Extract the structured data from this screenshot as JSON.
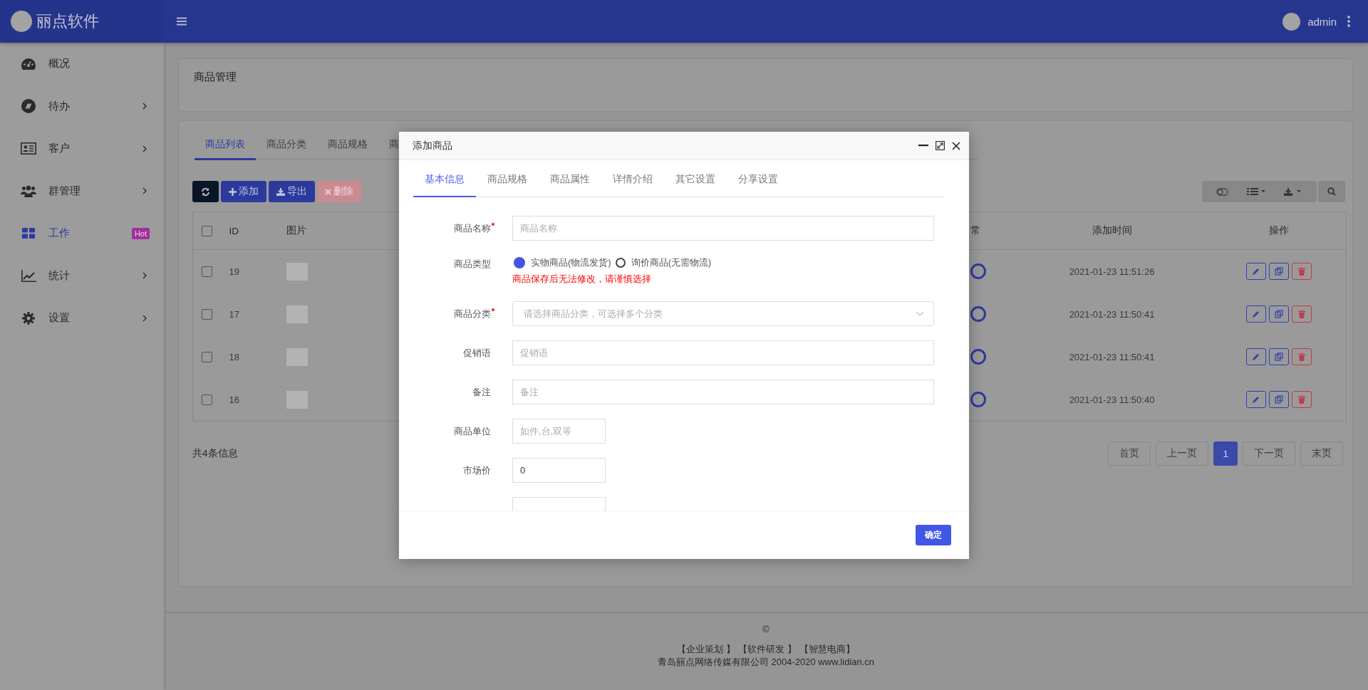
{
  "header": {
    "logo_text": "丽点软件",
    "user": "admin"
  },
  "sidebar": {
    "items": [
      {
        "label": "概况",
        "expandable": false,
        "selected": false
      },
      {
        "label": "待办",
        "expandable": true,
        "selected": false
      },
      {
        "label": "客户",
        "expandable": true,
        "selected": false
      },
      {
        "label": "群管理",
        "expandable": true,
        "selected": false
      },
      {
        "label": "工作",
        "badge": "Hot",
        "expandable": false,
        "selected": true
      },
      {
        "label": "统计",
        "expandable": true,
        "selected": false
      },
      {
        "label": "设置",
        "expandable": true,
        "selected": false
      }
    ]
  },
  "page_title": "商品管理",
  "tabs": [
    {
      "label": "商品列表",
      "selected": true
    },
    {
      "label": "商品分类",
      "selected": false
    },
    {
      "label": "商品规格",
      "selected": false
    },
    {
      "label": "商",
      "selected": false
    }
  ],
  "toolbar": [
    {
      "kind": "refresh",
      "disabled": false
    },
    {
      "kind": "add",
      "label": "添加",
      "disabled": false
    },
    {
      "kind": "export",
      "label": "导出",
      "disabled": false
    },
    {
      "kind": "delete",
      "label": "删除",
      "disabled": true
    }
  ],
  "table": {
    "all_checked": false,
    "columns": [
      "ID",
      "图片",
      "常",
      "添加时间",
      "操作"
    ],
    "rows": [
      {
        "checked": false,
        "id": "19",
        "time": "2021-01-23 11:51:26"
      },
      {
        "checked": false,
        "id": "17",
        "time": "2021-01-23 11:50:41"
      },
      {
        "checked": false,
        "id": "18",
        "time": "2021-01-23 11:50:41"
      },
      {
        "checked": false,
        "id": "16",
        "time": "2021-01-23 11:50:40"
      }
    ]
  },
  "record_count": "共4条信息",
  "pagination": [
    {
      "label": "首页",
      "selected": false
    },
    {
      "label": "上一页",
      "selected": false
    },
    {
      "label": "1",
      "selected": true
    },
    {
      "label": "下一页",
      "selected": false
    },
    {
      "label": "末页",
      "selected": false
    }
  ],
  "dialog": {
    "title": "添加商品",
    "tabs": [
      {
        "label": "基本信息",
        "selected": true
      },
      {
        "label": "商品规格",
        "selected": false
      },
      {
        "label": "商品属性",
        "selected": false
      },
      {
        "label": "详情介绍",
        "selected": false
      },
      {
        "label": "其它设置",
        "selected": false
      },
      {
        "label": "分享设置",
        "selected": false
      }
    ],
    "fields": [
      {
        "kind": "text",
        "label": "商品名称",
        "required": true,
        "placeholder": "商品名称",
        "short": false
      },
      {
        "kind": "radio",
        "label": "商品类型",
        "required": false,
        "options": [
          {
            "label": "实物商品(物流发货)",
            "selected": true
          },
          {
            "label": "询价商品(无需物流)",
            "selected": false
          }
        ],
        "note": "商品保存后无法修改，请谨慎选择"
      },
      {
        "kind": "select",
        "label": "商品分类",
        "required": true,
        "placeholder": "请选择商品分类，可选择多个分类"
      },
      {
        "kind": "text",
        "label": "促销语",
        "required": false,
        "placeholder": "促销语",
        "short": false
      },
      {
        "kind": "text",
        "label": "备注",
        "required": false,
        "placeholder": "备注",
        "short": false
      },
      {
        "kind": "text",
        "label": "商品单位",
        "required": false,
        "placeholder": "如件,台,双等",
        "short": true
      },
      {
        "kind": "text",
        "label": "市场价",
        "required": false,
        "value": "0",
        "short": true
      },
      {
        "kind": "text",
        "required": false,
        "short": true
      }
    ],
    "confirm": "确定"
  },
  "footer": {
    "copyright": "©",
    "links": [
      "【企业策划 】",
      "【软件研发 】",
      "【智慧电商】"
    ],
    "company": "青岛丽点网络传媒有限公司 2004-2020 www.lidian.cn"
  }
}
